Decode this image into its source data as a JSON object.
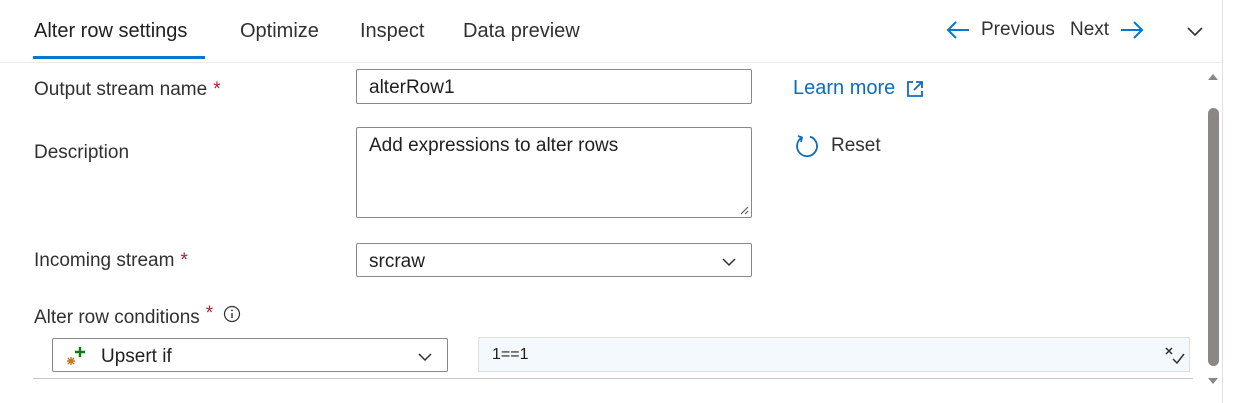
{
  "tabs": [
    "Alter row settings",
    "Optimize",
    "Inspect",
    "Data preview"
  ],
  "nav": {
    "previous_label": "Previous",
    "next_label": "Next"
  },
  "form": {
    "output_stream": {
      "label": "Output stream name",
      "required_mark": "*",
      "value": "alterRow1"
    },
    "description": {
      "label": "Description",
      "value": "Add expressions to alter rows"
    },
    "incoming_stream": {
      "label": "Incoming stream",
      "required_mark": "*",
      "value": "srcraw"
    },
    "conditions": {
      "label": "Alter row conditions",
      "required_mark": "*",
      "action_value": "Upsert if",
      "expression": "1==1"
    }
  },
  "links": {
    "learn_more": "Learn more",
    "reset": "Reset"
  },
  "colors": {
    "accent": "#0078d4",
    "link": "#0f6cbd",
    "required": "#a4262c",
    "expr_bg": "#f3f9fd"
  },
  "icons": [
    "arrow-left-icon",
    "arrow-right-icon",
    "chevron-down-icon",
    "external-link-icon",
    "refresh-icon",
    "info-icon",
    "upsert-icon",
    "expression-builder-icon",
    "scroll-up-icon",
    "scroll-down-icon"
  ]
}
